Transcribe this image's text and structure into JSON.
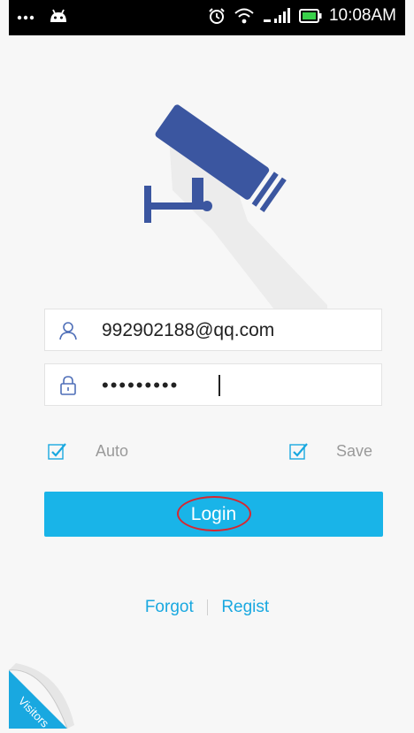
{
  "status_bar": {
    "time": "10:08AM",
    "left_icons": [
      "more-dots-icon",
      "android-icon"
    ],
    "right_icons": [
      "alarm-icon",
      "wifi-icon",
      "signal-icon",
      "battery-icon"
    ]
  },
  "logo": {
    "icon": "security-camera-icon",
    "color": "#3b56a0"
  },
  "login_form": {
    "username": {
      "icon": "user-icon",
      "value": "992902188@qq.com"
    },
    "password": {
      "icon": "lock-icon",
      "masked_value": "•••••••••"
    },
    "auto_checkbox": {
      "label": "Auto",
      "checked": true
    },
    "save_checkbox": {
      "label": "Save",
      "checked": true
    },
    "login_button_label": "Login"
  },
  "links": {
    "forgot": "Forgot",
    "regist": "Regist"
  },
  "visitors_corner": {
    "label": "Visitors"
  },
  "colors": {
    "accent": "#19b4e8",
    "annotation": "#d8262f",
    "background": "#f7f7f7"
  }
}
